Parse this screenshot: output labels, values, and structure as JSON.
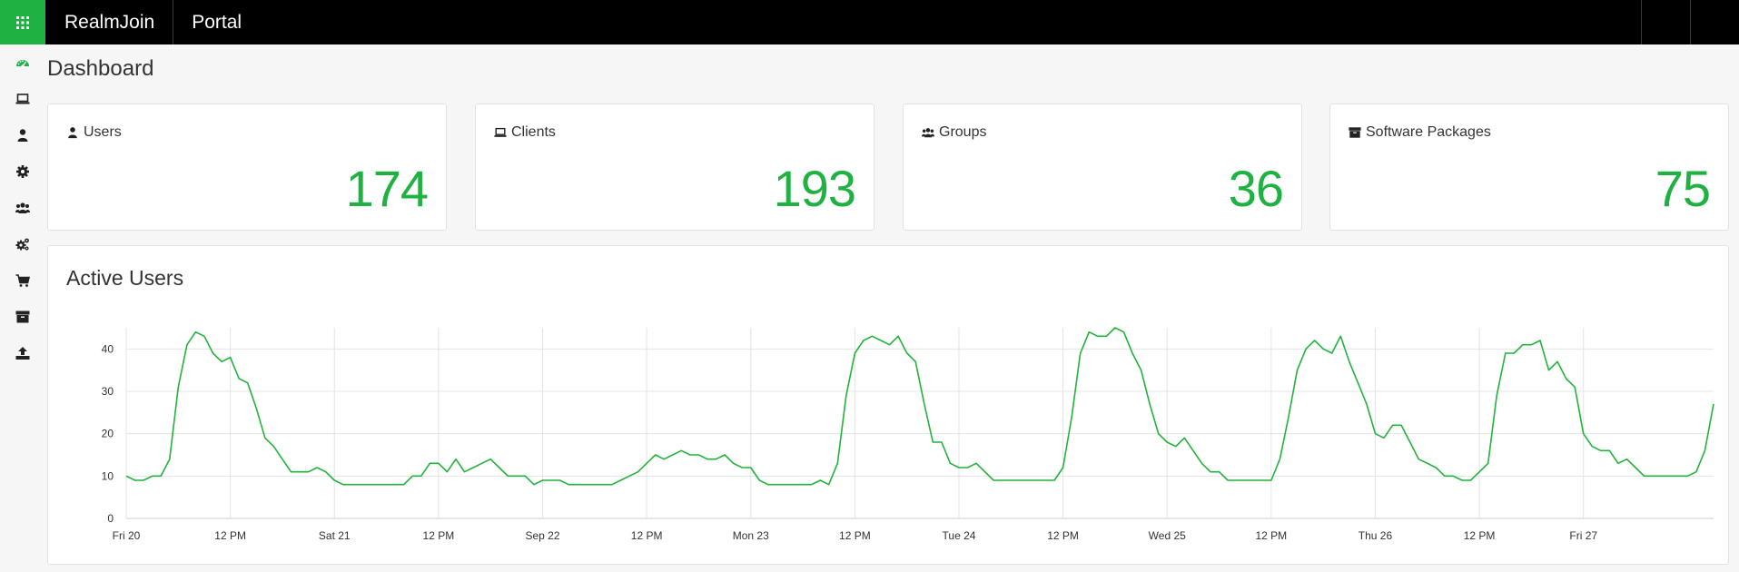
{
  "topbar": {
    "apps_icon": "grid-icon",
    "brand": "RealmJoin",
    "section": "Portal"
  },
  "sidebar": {
    "items": [
      {
        "name": "dashboard",
        "icon": "dashboard-icon",
        "active": true
      },
      {
        "name": "clients",
        "icon": "laptop-icon"
      },
      {
        "name": "users",
        "icon": "user-icon"
      },
      {
        "name": "settings",
        "icon": "gear-icon"
      },
      {
        "name": "groups",
        "icon": "users-icon"
      },
      {
        "name": "configuration",
        "icon": "gears-icon"
      },
      {
        "name": "store",
        "icon": "cart-icon"
      },
      {
        "name": "packages",
        "icon": "archive-icon"
      },
      {
        "name": "upload",
        "icon": "upload-icon"
      }
    ]
  },
  "page": {
    "title": "Dashboard"
  },
  "cards": [
    {
      "label": "Users",
      "icon": "user-icon",
      "value": "174"
    },
    {
      "label": "Clients",
      "icon": "laptop-icon",
      "value": "193"
    },
    {
      "label": "Groups",
      "icon": "users-icon",
      "value": "36"
    },
    {
      "label": "Software Packages",
      "icon": "archive-icon",
      "value": "75"
    }
  ],
  "colors": {
    "accent": "#1fb141",
    "topbar": "#000000",
    "sidebar_icon": "#222222",
    "line": "#22b33c"
  },
  "chart_data": {
    "type": "line",
    "title": "Active Users",
    "xlabel": "",
    "ylabel": "",
    "ylim": [
      0,
      45
    ],
    "yticks": [
      0,
      10,
      20,
      30,
      40
    ],
    "grid": true,
    "x_unit": "hour",
    "xticks": [
      {
        "hour": 0,
        "label": "Fri 20"
      },
      {
        "hour": 12,
        "label": "12 PM"
      },
      {
        "hour": 24,
        "label": "Sat 21"
      },
      {
        "hour": 36,
        "label": "12 PM"
      },
      {
        "hour": 48,
        "label": "Sep 22"
      },
      {
        "hour": 60,
        "label": "12 PM"
      },
      {
        "hour": 72,
        "label": "Mon 23"
      },
      {
        "hour": 84,
        "label": "12 PM"
      },
      {
        "hour": 96,
        "label": "Tue 24"
      },
      {
        "hour": 108,
        "label": "12 PM"
      },
      {
        "hour": 120,
        "label": "Wed 25"
      },
      {
        "hour": 132,
        "label": "12 PM"
      },
      {
        "hour": 144,
        "label": "Thu 26"
      },
      {
        "hour": 156,
        "label": "12 PM"
      },
      {
        "hour": 168,
        "label": "Fri 27"
      }
    ],
    "series": [
      {
        "values": [
          10,
          9,
          9,
          10,
          10,
          14,
          31,
          41,
          44,
          43,
          39,
          37,
          38,
          33,
          32,
          26,
          19,
          17,
          14,
          11,
          11,
          11,
          12,
          11,
          9,
          8,
          8,
          8,
          8,
          8,
          8,
          8,
          8,
          10,
          10,
          13,
          13,
          11,
          14,
          11,
          12,
          13,
          14,
          12,
          10,
          10,
          10,
          8,
          9,
          9,
          9,
          8,
          8,
          8,
          8,
          8,
          8,
          9,
          10,
          11,
          13,
          15,
          14,
          15,
          16,
          15,
          15,
          14,
          14,
          15,
          13,
          12,
          12,
          9,
          8,
          8,
          8,
          8,
          8,
          8,
          9,
          8,
          13,
          29,
          39,
          42,
          43,
          42,
          41,
          43,
          39,
          37,
          27,
          18,
          18,
          13,
          12,
          12,
          13,
          11,
          9,
          9,
          9,
          9,
          9,
          9,
          9,
          9,
          12,
          24,
          39,
          44,
          43,
          43,
          45,
          44,
          39,
          35,
          27,
          20,
          18,
          17,
          19,
          16,
          13,
          11,
          11,
          9,
          9,
          9,
          9,
          9,
          9,
          14,
          24,
          35,
          40,
          42,
          40,
          39,
          43,
          37,
          32,
          27,
          20,
          19,
          22,
          22,
          18,
          14,
          13,
          12,
          10,
          10,
          9,
          9,
          11,
          13,
          29,
          39,
          39,
          41,
          41,
          42,
          35,
          37,
          33,
          31,
          20,
          17,
          16,
          16,
          13,
          14,
          12,
          10,
          10,
          10,
          10,
          10,
          10,
          11,
          16,
          27
        ]
      }
    ]
  }
}
